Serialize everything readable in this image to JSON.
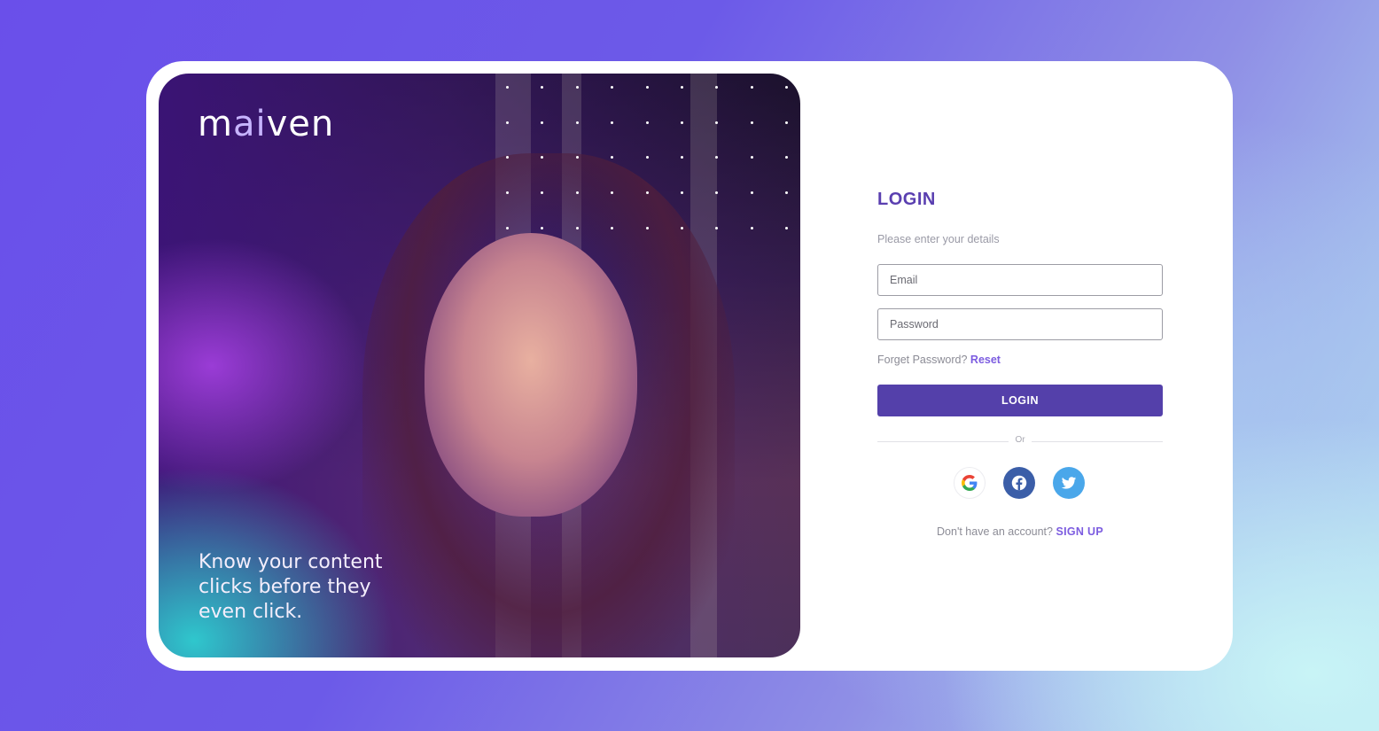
{
  "brand": {
    "logo_pre": "m",
    "logo_ai": "ai",
    "logo_post": "ven",
    "tagline": "Know your content clicks before they even click."
  },
  "login": {
    "title": "LOGIN",
    "subtitle": "Please enter your details",
    "email_placeholder": "Email",
    "password_placeholder": "Password",
    "forgot_text": "Forget Password?",
    "reset_label": "Reset",
    "login_button": "LOGIN",
    "divider_text": "Or",
    "signup_text": "Don't have an account?",
    "signup_label": "SIGN UP"
  },
  "social": [
    {
      "name": "Google",
      "icon": "google-icon"
    },
    {
      "name": "Facebook",
      "icon": "facebook-icon"
    },
    {
      "name": "Twitter",
      "icon": "twitter-icon"
    }
  ],
  "colors": {
    "primary": "#5440aa",
    "accent": "#7c5ce0",
    "title": "#5a3fb0",
    "facebook": "#3b5ea8",
    "twitter": "#4aa7ea"
  }
}
